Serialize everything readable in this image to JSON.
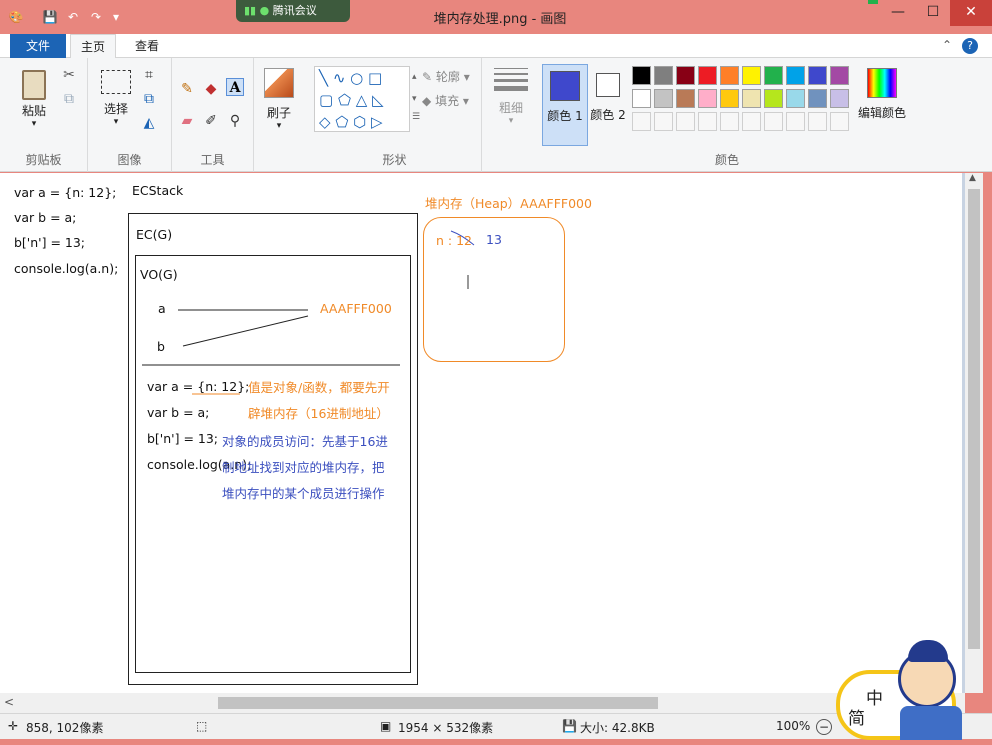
{
  "window": {
    "title": "堆内存处理.png - 画图",
    "meeting_badge": "腾讯会议",
    "min": "—",
    "max": "☐",
    "close": "✕"
  },
  "tabs": [
    "文件",
    "主页",
    "查看"
  ],
  "ribbon": {
    "clipboard": {
      "paste": "粘贴",
      "group": "剪贴板"
    },
    "image": {
      "select": "选择",
      "group": "图像"
    },
    "tools": {
      "group": "工具"
    },
    "brushes": {
      "label": "刷子"
    },
    "shapes": {
      "outline": "轮廓",
      "fill": "填充",
      "group": "形状"
    },
    "size": {
      "label": "粗细"
    },
    "colors": {
      "color1": "颜色 1",
      "color2": "颜色 2",
      "edit": "编辑颜色",
      "group": "颜色",
      "color1_value": "#3f48cc",
      "color2_value": "#ffffff",
      "palette_row1": [
        "#000000",
        "#7f7f7f",
        "#880015",
        "#ed1c24",
        "#ff7f27",
        "#fff200",
        "#22b14c",
        "#00a2e8",
        "#3f48cc",
        "#a349a4"
      ],
      "palette_row2": [
        "#ffffff",
        "#c3c3c3",
        "#b97a57",
        "#ffaec9",
        "#ffc90e",
        "#efe4b0",
        "#b5e61d",
        "#99d9ea",
        "#7092be",
        "#c8bfe7"
      ]
    }
  },
  "drawing": {
    "code_lines": [
      "var a = {n: 12};",
      "var b = a;",
      "b['n'] = 13;",
      "console.log(a.n);"
    ],
    "ecstack": "ECStack",
    "ecg": "EC(G)",
    "vog": "VO(G)",
    "var_a": "a",
    "var_b": "b",
    "address": "AAAFFF000",
    "inner_code": [
      "var a = {n: 12};",
      "var b = a;",
      "b['n'] = 13;",
      "console.log(a.n);"
    ],
    "note_orange_1": "值是对象/函数，都要先开",
    "note_orange_2": "辟堆内存（16进制地址）",
    "note_blue_1": "对象的成员访问：先基于16进",
    "note_blue_2": "制地址找到对应的堆内存，把",
    "note_blue_3": "堆内存中的某个成员进行操作",
    "heap_title": "堆内存（Heap）AAAFFF000",
    "heap_key": "n : 12",
    "heap_new_value": "13"
  },
  "status": {
    "cursor": "858, 102像素",
    "dimensions": "1954 × 532像素",
    "size": "大小: 42.8KB",
    "zoom": "100%"
  },
  "mascot": {
    "text1": "中",
    "text2": "简"
  }
}
